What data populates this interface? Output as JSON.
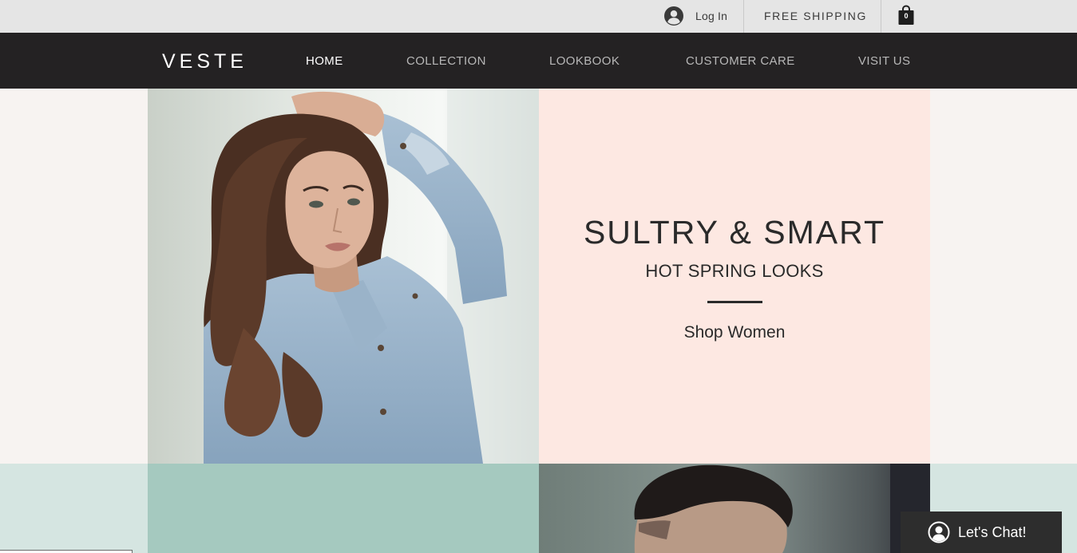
{
  "top_bar": {
    "login_label": "Log In",
    "shipping_label": "FREE SHIPPING",
    "cart_count": "0"
  },
  "header": {
    "logo": "VESTE",
    "nav": [
      {
        "label": "HOME",
        "active": true
      },
      {
        "label": "COLLECTION",
        "active": false
      },
      {
        "label": "LOOKBOOK",
        "active": false
      },
      {
        "label": "CUSTOMER CARE",
        "active": false
      },
      {
        "label": "VISIT US",
        "active": false
      }
    ]
  },
  "hero": {
    "title": "SULTRY & SMART",
    "subtitle": "HOT SPRING LOOKS",
    "cta": "Shop Women"
  },
  "chat": {
    "label": "Let's Chat!"
  },
  "colors": {
    "top_bar_bg": "#e5e5e5",
    "nav_bg": "#242223",
    "hero_panel_bg": "#fde8e2",
    "mint_block": "#a5c9bf",
    "chat_bg": "#2d2d2d"
  },
  "icons": {
    "login": "user-avatar-icon",
    "cart": "shopping-bag-icon",
    "chat": "user-avatar-icon"
  }
}
